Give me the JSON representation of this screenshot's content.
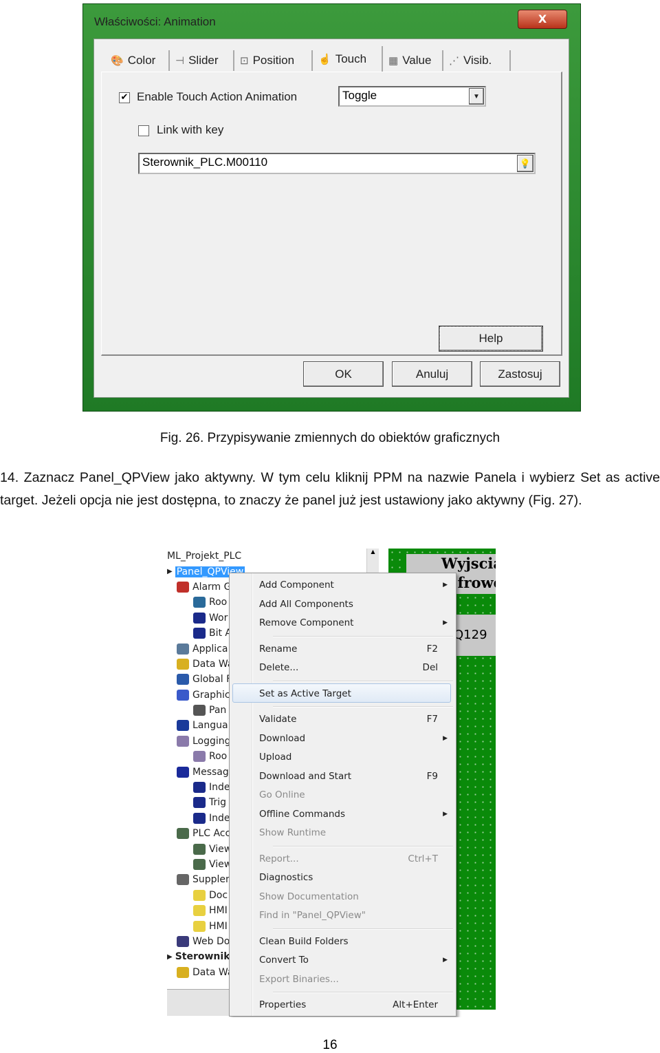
{
  "dialog": {
    "title": "Właściwości: Animation",
    "close_label": "X",
    "tabs": [
      {
        "label": "Color",
        "icon": "color-wheel-icon"
      },
      {
        "label": "Slider",
        "icon": "slider-icon"
      },
      {
        "label": "Position",
        "icon": "position-icon"
      },
      {
        "label": "Touch",
        "icon": "hand-pointer-icon",
        "active": true
      },
      {
        "label": "Value",
        "icon": "value-123-icon"
      },
      {
        "label": "Visib.",
        "icon": "visibility-icon"
      }
    ],
    "enable_touch": {
      "label": "Enable Touch Action Animation",
      "checked": true
    },
    "action_select": {
      "value": "Toggle"
    },
    "link_with_key": {
      "label": "Link with key",
      "checked": false
    },
    "tag_input": {
      "value": "Sterownik_PLC.M00110"
    },
    "help": "Help",
    "ok": "OK",
    "cancel": "Anuluj",
    "apply": "Zastosuj"
  },
  "caption": "Fig. 26. Przypisywanie zmiennych do obiektów graficznych",
  "paragraph": "14. Zaznacz Panel_QPView jako aktywny. W tym celu kliknij PPM na nazwie Panela i wybierz Set as active target. Jeżeli opcja nie jest dostępna, to znaczy że panel już jest ustawiony jako aktywny (Fig. 27).",
  "screenshot2": {
    "tree": [
      {
        "label": "ML_Projekt_PLC",
        "level": 0,
        "color": ""
      },
      {
        "label": "Panel_QPView",
        "level": 0,
        "selected": true,
        "color": ""
      },
      {
        "label": "Alarm G",
        "level": 1,
        "color": "#c0302a"
      },
      {
        "label": "Roo",
        "level": 2,
        "color": "#2a6a9a"
      },
      {
        "label": "Wor",
        "level": 2,
        "color": "#1a2a8a"
      },
      {
        "label": "Bit A",
        "level": 2,
        "color": "#1a2a8a"
      },
      {
        "label": "Applica",
        "level": 1,
        "color": "#5a7a9a"
      },
      {
        "label": "Data Wa",
        "level": 1,
        "color": "#d8b020"
      },
      {
        "label": "Global F",
        "level": 1,
        "color": "#2a5aaa"
      },
      {
        "label": "Graphic",
        "level": 1,
        "color": "#3a5aca"
      },
      {
        "label": "Pan",
        "level": 2,
        "color": "#555"
      },
      {
        "label": "Langua",
        "level": 1,
        "color": "#1a3a9a"
      },
      {
        "label": "Logging",
        "level": 1,
        "color": "#8a7aaa"
      },
      {
        "label": "Roo",
        "level": 2,
        "color": "#8a7aaa"
      },
      {
        "label": "Messag",
        "level": 1,
        "color": "#1a2a9a"
      },
      {
        "label": "Inde",
        "level": 2,
        "color": "#1a2a8a"
      },
      {
        "label": "Trig",
        "level": 2,
        "color": "#1a2a8a"
      },
      {
        "label": "Inde",
        "level": 2,
        "color": "#1a2a8a"
      },
      {
        "label": "PLC Acc",
        "level": 1,
        "color": "#4a6a4a"
      },
      {
        "label": "View",
        "level": 2,
        "color": "#4a6a4a"
      },
      {
        "label": "View",
        "level": 2,
        "color": "#4a6a4a"
      },
      {
        "label": "Supplem",
        "level": 1,
        "color": "#666"
      },
      {
        "label": "Doc",
        "level": 2,
        "color": "#e8d040"
      },
      {
        "label": "HMI",
        "level": 2,
        "color": "#e8d040"
      },
      {
        "label": "HMI",
        "level": 2,
        "color": "#e8d040"
      },
      {
        "label": "Web Do",
        "level": 1,
        "color": "#3a3a7a"
      },
      {
        "label": "Sterownik",
        "level": 0,
        "bold": true,
        "color": ""
      },
      {
        "label": "Data Wa",
        "level": 1,
        "color": "#d8b020"
      }
    ],
    "canvas": {
      "header1": "Wyjscia",
      "header2": "frowe",
      "label": "Q129"
    },
    "menu": [
      {
        "label": "Add Component",
        "submenu": true
      },
      {
        "label": "Add All Components"
      },
      {
        "label": "Remove Component",
        "submenu": true
      },
      {
        "sep": true
      },
      {
        "label": "Rename",
        "shortcut": "F2"
      },
      {
        "label": "Delete...",
        "shortcut": "Del"
      },
      {
        "sep": true
      },
      {
        "label": "Set as Active Target",
        "highlighted": true
      },
      {
        "sep": true
      },
      {
        "label": "Validate",
        "shortcut": "F7"
      },
      {
        "label": "Download",
        "submenu": true
      },
      {
        "label": "Upload"
      },
      {
        "label": "Download and Start",
        "shortcut": "F9"
      },
      {
        "label": "Go Online",
        "disabled": true
      },
      {
        "label": "Offline Commands",
        "submenu": true
      },
      {
        "label": "Show Runtime",
        "disabled": true
      },
      {
        "sep": true
      },
      {
        "label": "Report...",
        "shortcut": "Ctrl+T",
        "disabled": true
      },
      {
        "label": "Diagnostics"
      },
      {
        "label": "Show Documentation",
        "disabled": true
      },
      {
        "label": "Find in \"Panel_QPView\"",
        "disabled": true
      },
      {
        "sep": true
      },
      {
        "label": "Clean Build Folders"
      },
      {
        "label": "Convert To",
        "submenu": true
      },
      {
        "label": "Export Binaries...",
        "disabled": true
      },
      {
        "sep": true
      },
      {
        "label": "Properties",
        "shortcut": "Alt+Enter"
      }
    ]
  },
  "page_number": "16"
}
